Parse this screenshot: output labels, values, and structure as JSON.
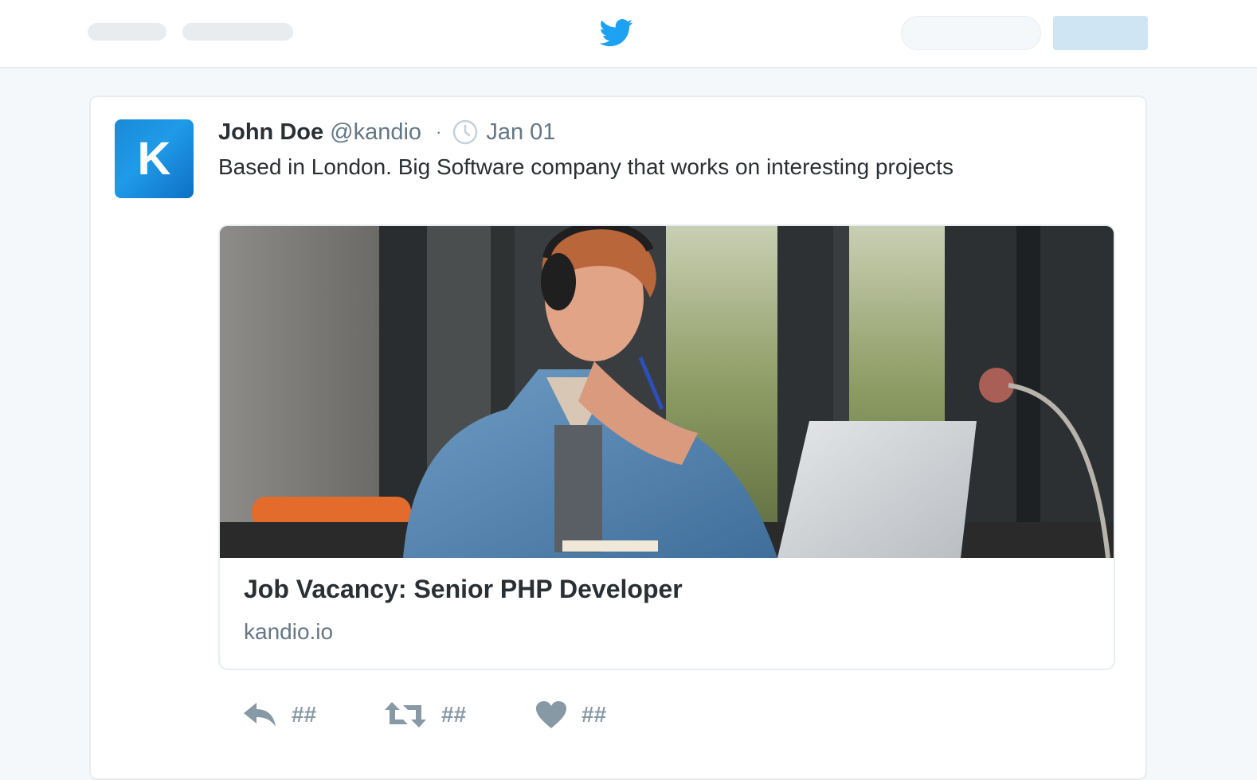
{
  "colors": {
    "brand_blue": "#1da1f2",
    "avatar_gradient": [
      "#1a8ad8",
      "#0f6fc4"
    ],
    "secondary_text": "#657786",
    "action_gray": "#8899a6",
    "border": "#e6ecf0"
  },
  "header": {
    "logo_icon": "twitter-bird-icon"
  },
  "tweet": {
    "avatar_letter": "K",
    "display_name": "John Doe",
    "handle": "@kandio",
    "separator": "·",
    "date": "Jan 01",
    "text": "Based in London. Big Software company that works on interesting projects",
    "link_card": {
      "title": "Job Vacancy: Senior PHP Developer",
      "domain": "kandio.io"
    },
    "actions": {
      "reply_count": "##",
      "retweet_count": "##",
      "like_count": "##"
    }
  }
}
